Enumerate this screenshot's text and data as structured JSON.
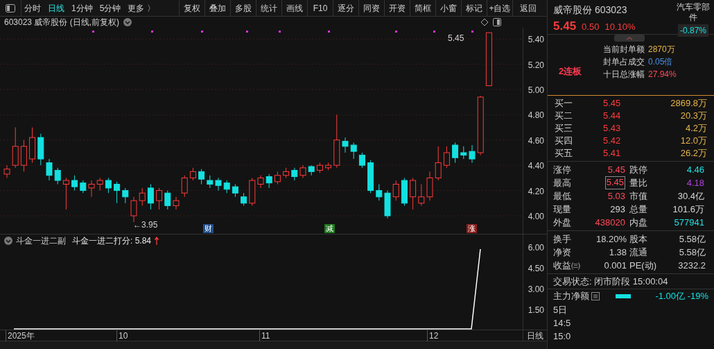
{
  "toolbar": {
    "period_tabs": [
      {
        "label": "分时",
        "selected": false
      },
      {
        "label": "日线",
        "selected": true
      },
      {
        "label": "1分钟",
        "selected": false
      },
      {
        "label": "5分钟",
        "selected": false
      },
      {
        "label": "更多 〉",
        "selected": false
      }
    ],
    "buttons": [
      "复权",
      "叠加",
      "多股",
      "统计",
      "画线",
      "F10",
      "逐分",
      "同资",
      "开资",
      "简框",
      "小窗",
      "标记",
      "+自选",
      "返回"
    ]
  },
  "chart": {
    "title": "603023 威帝股份 (日线,前复权)",
    "price_ticks": [
      "5.40",
      "5.20",
      "5.00",
      "4.80",
      "4.60",
      "4.40",
      "4.20",
      "4.00"
    ],
    "high_label": "5.45",
    "low_label": "←3.95",
    "events": [
      {
        "label": "财",
        "color": "#1f4e8c"
      },
      {
        "label": "减",
        "color": "#1e7a1e"
      },
      {
        "label": "涨",
        "color": "#8c1c1c"
      }
    ]
  },
  "indicator": {
    "name": "斗金一进二副",
    "score_label": "斗金一进二打分: 5.84",
    "ticks": [
      "6.00",
      "4.50",
      "3.00",
      "1.50"
    ]
  },
  "date_axis": {
    "labels": [
      "2025年",
      "10",
      "11",
      "12"
    ],
    "period": "日线"
  },
  "quote": {
    "name": "威帝股份 603023",
    "sector": "汽车零部件",
    "sector_change": "-0.87%",
    "price": "5.45",
    "change": "0.50",
    "change_pct": "10.10%",
    "streak": "2连板",
    "seal": [
      {
        "label": "当前封单额",
        "value": "2870万",
        "color": "#e8b64a"
      },
      {
        "label": "封单占成交",
        "value": "0.05倍",
        "color": "#4a8fe0"
      },
      {
        "label": "十日总涨幅",
        "value": "27.94%",
        "color": "#ff4a5a"
      }
    ],
    "bids": [
      {
        "label": "买一",
        "price": "5.45",
        "volume": "2869.8万"
      },
      {
        "label": "买二",
        "price": "5.44",
        "volume": "20.3万"
      },
      {
        "label": "买三",
        "price": "5.43",
        "volume": "4.2万"
      },
      {
        "label": "买四",
        "price": "5.42",
        "volume": "12.0万"
      },
      {
        "label": "买五",
        "price": "5.41",
        "volume": "26.2万"
      }
    ],
    "stats": [
      {
        "label": "涨停",
        "value": "5.45",
        "color": "#ff4a5a",
        "highlighted": false
      },
      {
        "label": "跌停",
        "value": "4.46",
        "color": "#22e0e0",
        "highlighted": false
      },
      {
        "label": "最高",
        "value": "5.45",
        "color": "#ff4a5a",
        "highlighted": true
      },
      {
        "label": "量比",
        "value": "4.18",
        "color": "#b040d8",
        "highlighted": false
      },
      {
        "label": "最低",
        "value": "5.03",
        "color": "#ff4a5a",
        "highlighted": false
      },
      {
        "label": "市值",
        "value": "30.4亿",
        "color": "#d8d8d8",
        "highlighted": false
      },
      {
        "label": "现量",
        "value": "293",
        "color": "#d8d8d8",
        "highlighted": false
      },
      {
        "label": "总量",
        "value": "101.6万",
        "color": "#d8d8d8",
        "highlighted": false
      },
      {
        "label": "外盘",
        "value": "438020",
        "color": "#ff4a5a",
        "highlighted": false
      },
      {
        "label": "内盘",
        "value": "577941",
        "color": "#22e0e0",
        "highlighted": false
      }
    ],
    "finance": [
      {
        "label": "换手",
        "value": "18.20%"
      },
      {
        "label": "股本",
        "value": "5.58亿"
      },
      {
        "label": "净资",
        "value": "1.38"
      },
      {
        "label": "流通",
        "value": "5.58亿"
      },
      {
        "label": "收益㈢",
        "value": "0.001"
      },
      {
        "label": "PE(动)",
        "value": "3232.2"
      }
    ],
    "trade_status": "交易状态: 闭市阶段 15:00:04",
    "main_flow": {
      "label": "主力净额",
      "value": "-1.00亿 -19%"
    },
    "more_rows": [
      "5日",
      "14:5",
      "15:0"
    ]
  }
}
